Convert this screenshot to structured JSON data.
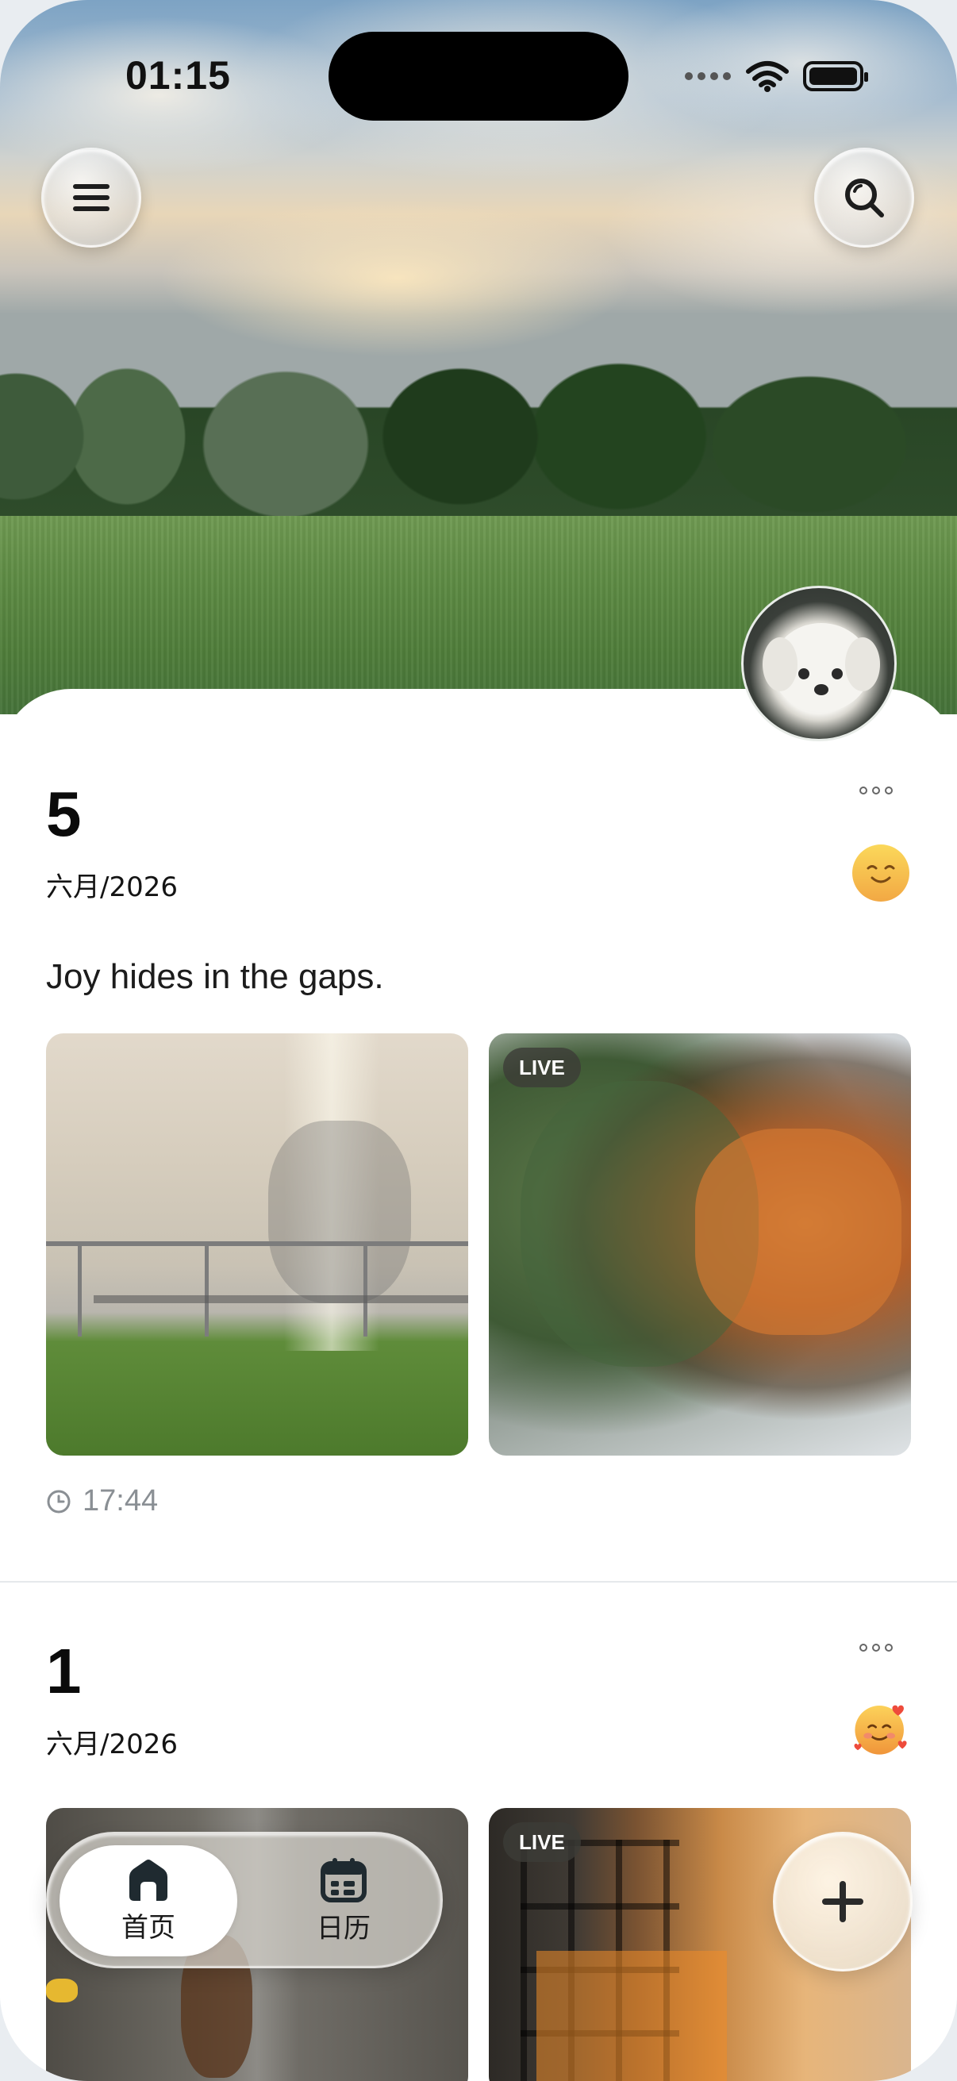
{
  "status_bar": {
    "time": "01:15",
    "icons": [
      "signal-dots-icon",
      "wifi-icon",
      "battery-icon"
    ]
  },
  "header": {
    "menu_icon": "menu-icon",
    "search_icon": "search-icon"
  },
  "entries": [
    {
      "day": "5",
      "month_year": "六月/2026",
      "mood_icon": "smiling-face-icon",
      "text": "Joy hides in the gaps.",
      "photos": [
        {
          "live": false
        },
        {
          "live": true,
          "live_label": "LIVE"
        }
      ],
      "time": "17:44"
    },
    {
      "day": "1",
      "month_year": "六月/2026",
      "mood_icon": "smiling-face-with-hearts-icon",
      "photos": [
        {
          "live": false
        },
        {
          "live": true,
          "live_label": "LIVE"
        }
      ]
    }
  ],
  "tabbar": {
    "tabs": [
      {
        "label": "首页",
        "icon": "home-icon",
        "active": true
      },
      {
        "label": "日历",
        "icon": "calendar-icon",
        "active": false
      }
    ]
  },
  "fab": {
    "icon": "plus-icon"
  },
  "colors": {
    "sheet": "#ffffff",
    "mood_yellow": "#f7c34a",
    "muted_text": "#8a8f94"
  }
}
